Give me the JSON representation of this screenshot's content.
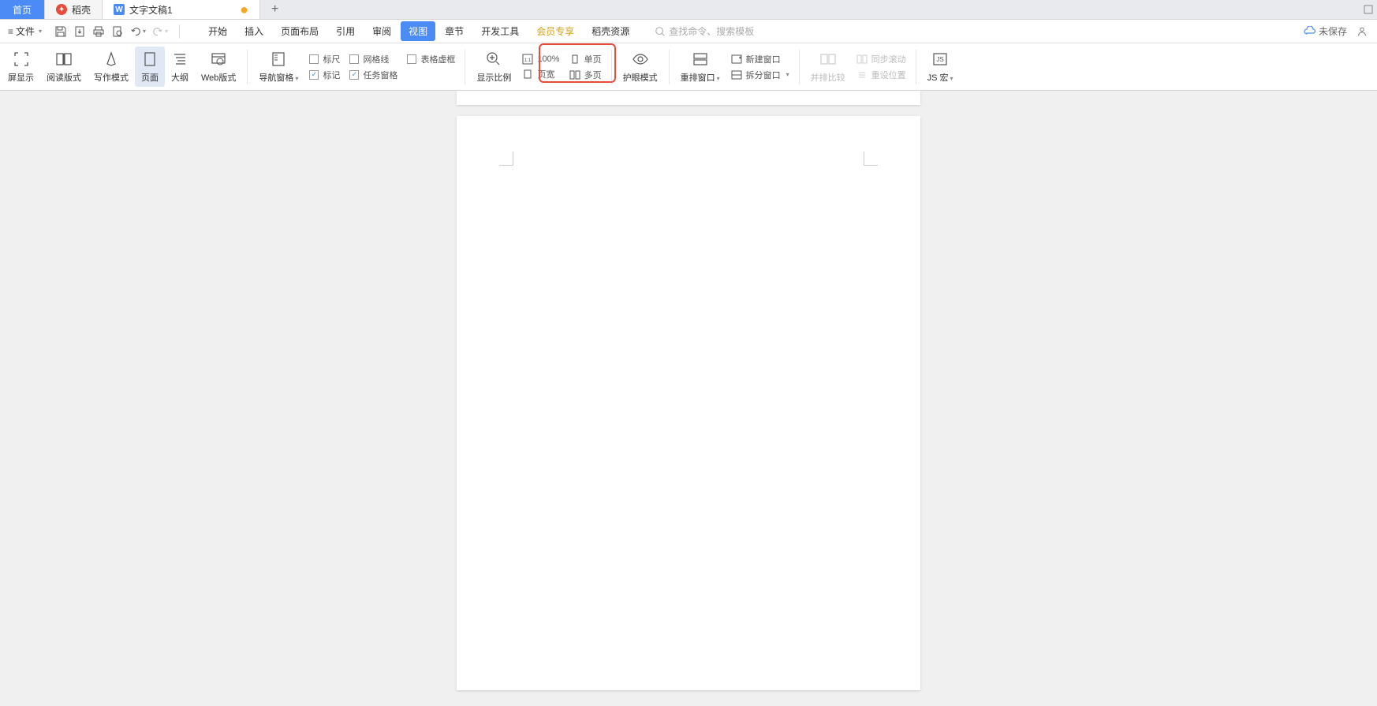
{
  "tabs": {
    "home": "首页",
    "docker": "稻壳",
    "doc": "文字文稿1",
    "modified_indicator": "●",
    "add": "+"
  },
  "file_menu": "文件",
  "menu_tabs": [
    "开始",
    "插入",
    "页面布局",
    "引用",
    "审阅",
    "视图",
    "章节",
    "开发工具",
    "会员专享",
    "稻壳资源"
  ],
  "menu_tabs_active_index": 5,
  "menu_tabs_gold_index": 8,
  "search_placeholder": "查找命令、搜索模板",
  "menu_right": {
    "unsaved": "未保存"
  },
  "ribbon": {
    "fullscreen": "屏显示",
    "read_layout": "阅读版式",
    "write_mode": "写作模式",
    "page": "页面",
    "outline": "大纲",
    "web_layout": "Web版式",
    "nav_pane": "导航窗格",
    "ruler": "标尺",
    "gridlines": "网格线",
    "table_gridlines": "表格虚框",
    "markup": "标记",
    "task_pane": "任务窗格",
    "zoom_ratio": "显示比例",
    "percent_100": "100%",
    "page_width": "页宽",
    "single_page": "单页",
    "multi_page": "多页",
    "eye_mode": "护眼模式",
    "arrange_windows": "重排窗口",
    "new_window": "新建窗口",
    "split_window": "拆分窗口",
    "side_by_side": "并排比较",
    "sync_scroll": "同步滚动",
    "reset_position": "重设位置",
    "js_macro": "JS 宏"
  }
}
